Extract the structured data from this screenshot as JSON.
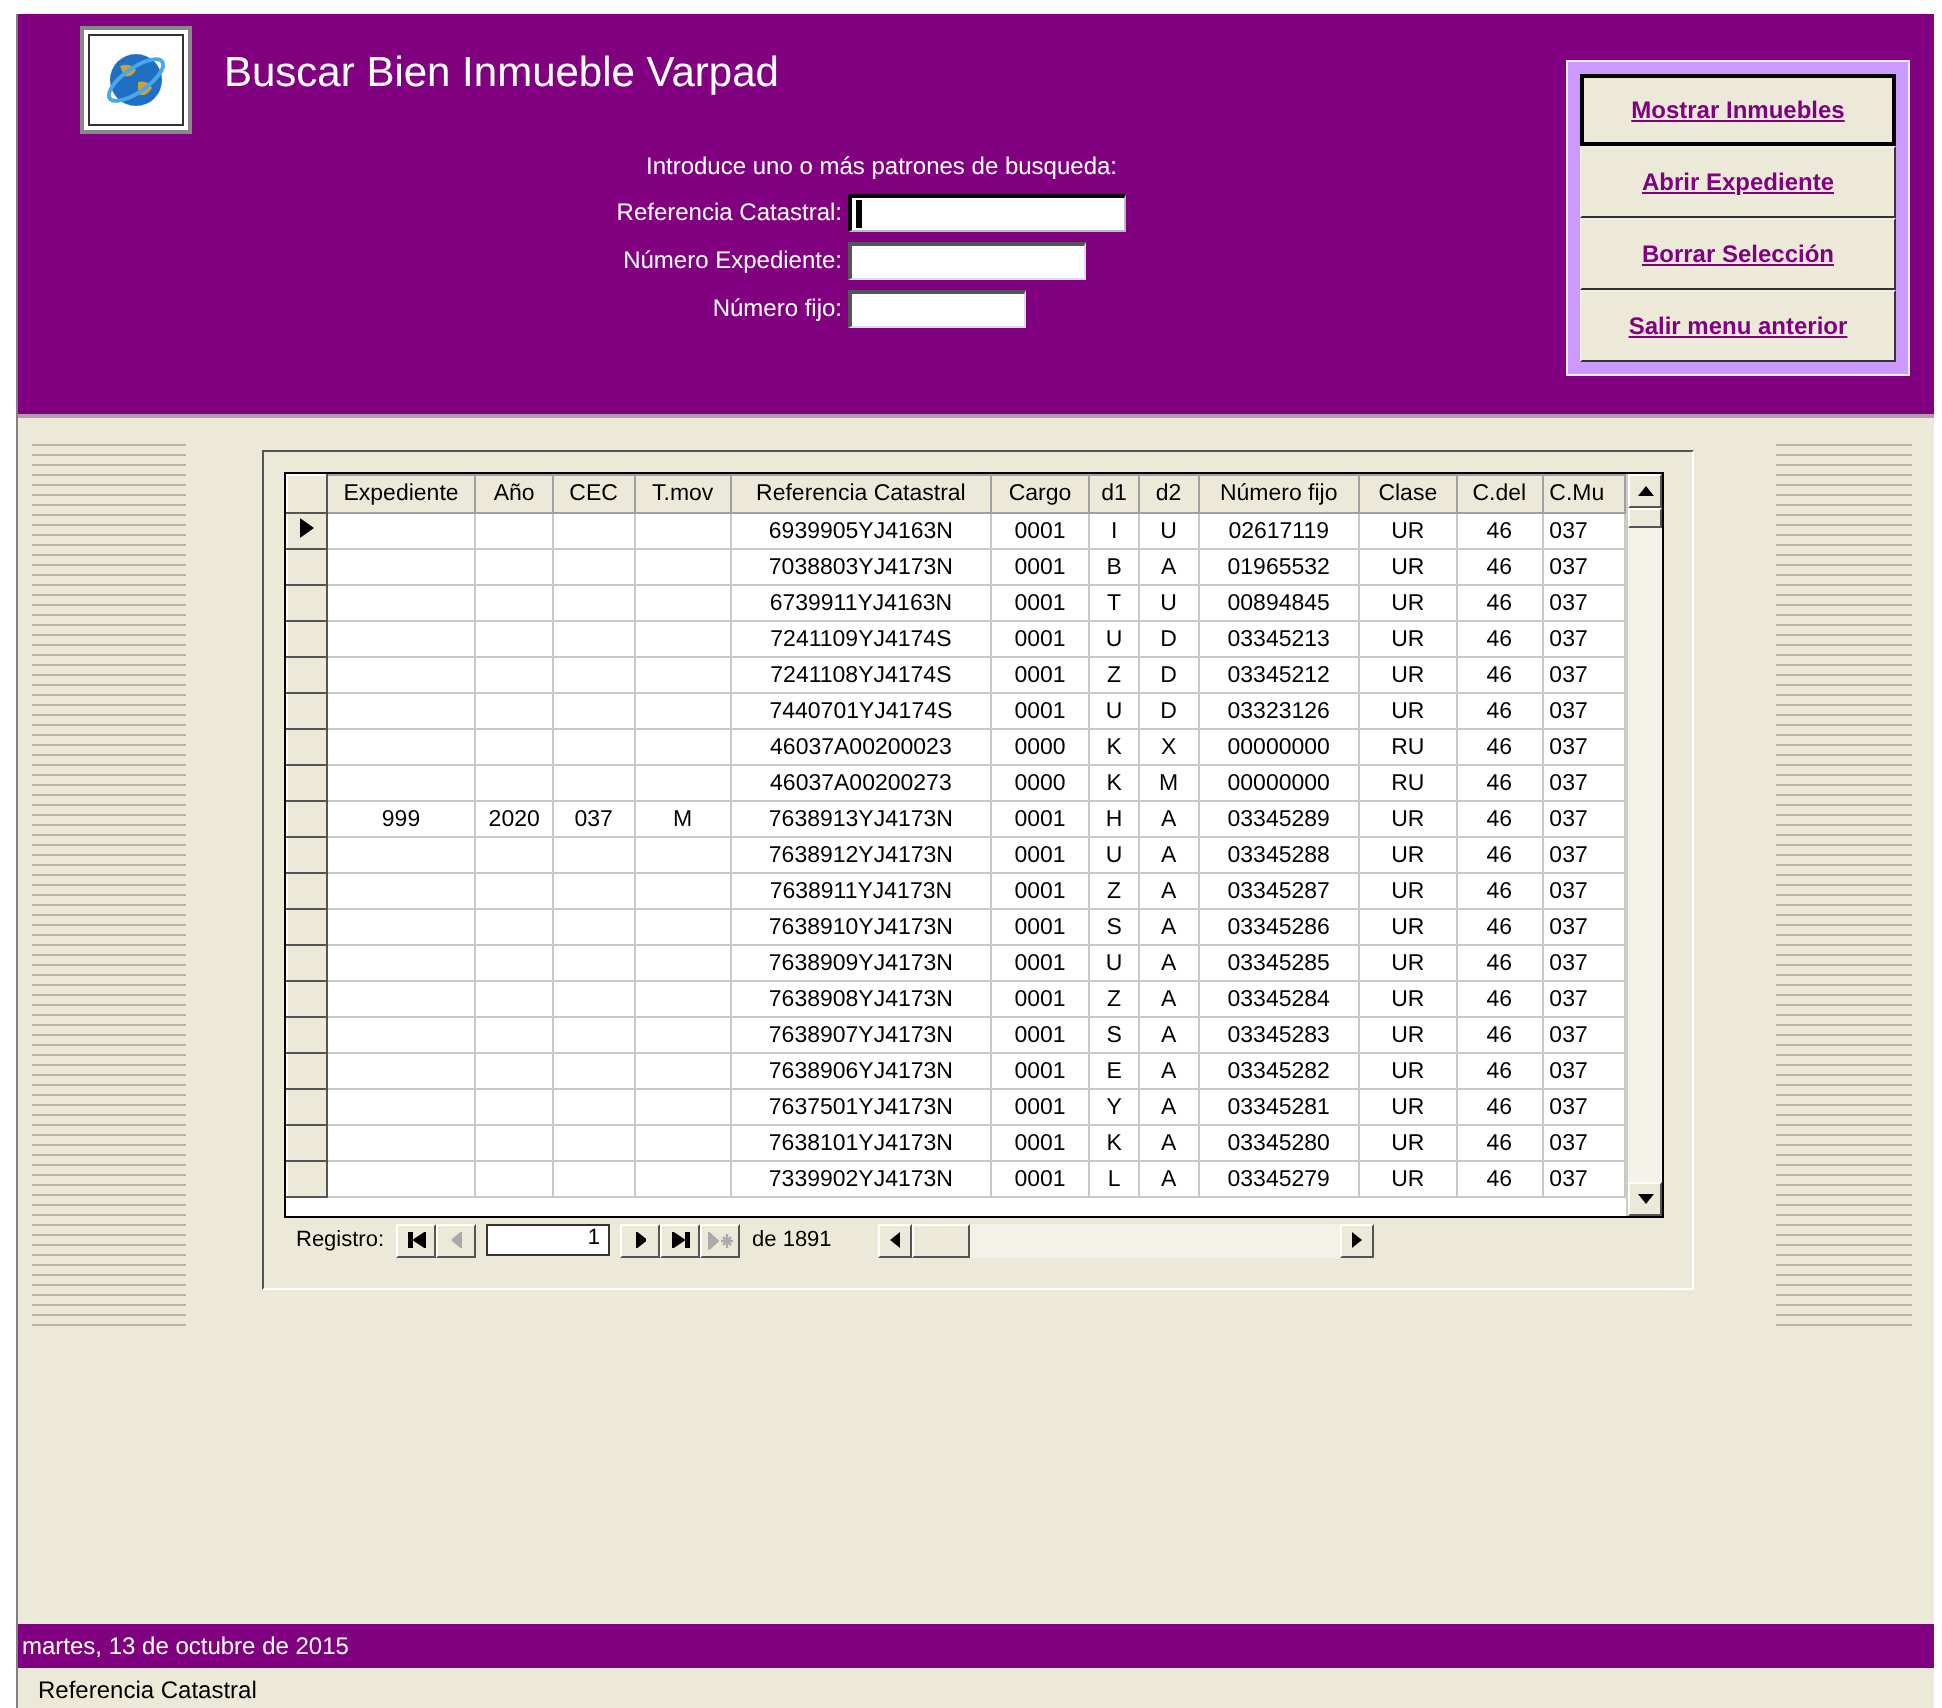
{
  "header": {
    "title": "Buscar Bien Inmueble Varpad",
    "instruction": "Introduce uno o más patrones de busqueda:"
  },
  "search_fields": [
    {
      "label": "Referencia Catastral:",
      "focused": true
    },
    {
      "label": "Número Expediente:",
      "focused": false
    },
    {
      "label": "Número fijo:",
      "focused": false
    }
  ],
  "buttons": [
    {
      "label": "Mostrar Inmuebles",
      "focused": true
    },
    {
      "label": "Abrir Expediente",
      "focused": false
    },
    {
      "label": "Borrar Selección",
      "focused": false
    },
    {
      "label": "Salir menu anterior",
      "focused": false
    }
  ],
  "table": {
    "columns": [
      "Expediente",
      "Año",
      "CEC",
      "T.mov",
      "Referencia Catastral",
      "Cargo",
      "d1",
      "d2",
      "Número fijo",
      "Clase",
      "C.del",
      "C.Mu"
    ],
    "rows": [
      {
        "current": true,
        "ref": "6939905YJ4163N",
        "cargo": "0001",
        "d1": "I",
        "d2": "U",
        "numero_fijo": "02617119",
        "clase": "UR",
        "c_del": "46",
        "c_mu": "037"
      },
      {
        "current": false,
        "ref": "7038803YJ4173N",
        "cargo": "0001",
        "d1": "B",
        "d2": "A",
        "numero_fijo": "01965532",
        "clase": "UR",
        "c_del": "46",
        "c_mu": "037"
      },
      {
        "current": false,
        "ref": "6739911YJ4163N",
        "cargo": "0001",
        "d1": "T",
        "d2": "U",
        "numero_fijo": "00894845",
        "clase": "UR",
        "c_del": "46",
        "c_mu": "037"
      },
      {
        "current": false,
        "ref": "7241109YJ4174S",
        "cargo": "0001",
        "d1": "U",
        "d2": "D",
        "numero_fijo": "03345213",
        "clase": "UR",
        "c_del": "46",
        "c_mu": "037"
      },
      {
        "current": false,
        "ref": "7241108YJ4174S",
        "cargo": "0001",
        "d1": "Z",
        "d2": "D",
        "numero_fijo": "03345212",
        "clase": "UR",
        "c_del": "46",
        "c_mu": "037"
      },
      {
        "current": false,
        "ref": "7440701YJ4174S",
        "cargo": "0001",
        "d1": "U",
        "d2": "D",
        "numero_fijo": "03323126",
        "clase": "UR",
        "c_del": "46",
        "c_mu": "037"
      },
      {
        "current": false,
        "ref": "46037A00200023",
        "cargo": "0000",
        "d1": "K",
        "d2": "X",
        "numero_fijo": "00000000",
        "clase": "RU",
        "c_del": "46",
        "c_mu": "037"
      },
      {
        "current": false,
        "ref": "46037A00200273",
        "cargo": "0000",
        "d1": "K",
        "d2": "M",
        "numero_fijo": "00000000",
        "clase": "RU",
        "c_del": "46",
        "c_mu": "037"
      },
      {
        "current": false,
        "expediente": "999",
        "ano": "2020",
        "cec": "037",
        "t_mov": "M",
        "ref": "7638913YJ4173N",
        "cargo": "0001",
        "d1": "H",
        "d2": "A",
        "numero_fijo": "03345289",
        "clase": "UR",
        "c_del": "46",
        "c_mu": "037"
      },
      {
        "current": false,
        "ref": "7638912YJ4173N",
        "cargo": "0001",
        "d1": "U",
        "d2": "A",
        "numero_fijo": "03345288",
        "clase": "UR",
        "c_del": "46",
        "c_mu": "037"
      },
      {
        "current": false,
        "ref": "7638911YJ4173N",
        "cargo": "0001",
        "d1": "Z",
        "d2": "A",
        "numero_fijo": "03345287",
        "clase": "UR",
        "c_del": "46",
        "c_mu": "037"
      },
      {
        "current": false,
        "ref": "7638910YJ4173N",
        "cargo": "0001",
        "d1": "S",
        "d2": "A",
        "numero_fijo": "03345286",
        "clase": "UR",
        "c_del": "46",
        "c_mu": "037"
      },
      {
        "current": false,
        "ref": "7638909YJ4173N",
        "cargo": "0001",
        "d1": "U",
        "d2": "A",
        "numero_fijo": "03345285",
        "clase": "UR",
        "c_del": "46",
        "c_mu": "037"
      },
      {
        "current": false,
        "ref": "7638908YJ4173N",
        "cargo": "0001",
        "d1": "Z",
        "d2": "A",
        "numero_fijo": "03345284",
        "clase": "UR",
        "c_del": "46",
        "c_mu": "037"
      },
      {
        "current": false,
        "ref": "7638907YJ4173N",
        "cargo": "0001",
        "d1": "S",
        "d2": "A",
        "numero_fijo": "03345283",
        "clase": "UR",
        "c_del": "46",
        "c_mu": "037"
      },
      {
        "current": false,
        "ref": "7638906YJ4173N",
        "cargo": "0001",
        "d1": "E",
        "d2": "A",
        "numero_fijo": "03345282",
        "clase": "UR",
        "c_del": "46",
        "c_mu": "037"
      },
      {
        "current": false,
        "ref": "7637501YJ4173N",
        "cargo": "0001",
        "d1": "Y",
        "d2": "A",
        "numero_fijo": "03345281",
        "clase": "UR",
        "c_del": "46",
        "c_mu": "037"
      },
      {
        "current": false,
        "ref": "7638101YJ4173N",
        "cargo": "0001",
        "d1": "K",
        "d2": "A",
        "numero_fijo": "03345280",
        "clase": "UR",
        "c_del": "46",
        "c_mu": "037"
      },
      {
        "current": false,
        "ref": "7339902YJ4173N",
        "cargo": "0001",
        "d1": "L",
        "d2": "A",
        "numero_fijo": "03345279",
        "clase": "UR",
        "c_del": "46",
        "c_mu": "037"
      }
    ]
  },
  "navigation": {
    "label": "Registro:",
    "record": "1",
    "total": "de 1891",
    "prev_disabled": true,
    "new_disabled": true
  },
  "footer": {
    "date": "martes, 13 de octubre de 2015"
  },
  "status_bar": {
    "text": "Referencia Catastral"
  }
}
